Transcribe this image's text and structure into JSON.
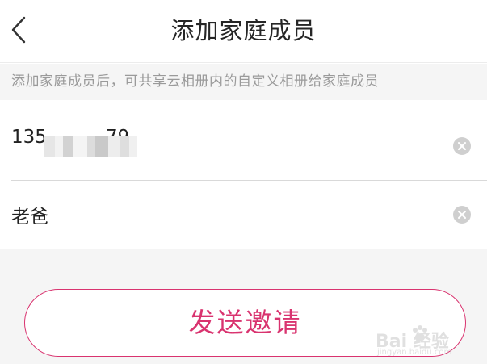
{
  "header": {
    "back_icon": "chevron-left-icon",
    "title": "添加家庭成员"
  },
  "notice": {
    "text": "添加家庭成员后，可共享云相册内的自定义相册给家庭成员"
  },
  "form": {
    "phone": {
      "value": "135          79",
      "clear_icon": "clear-circle-icon"
    },
    "name": {
      "value": "老爸",
      "clear_icon": "clear-circle-icon"
    }
  },
  "actions": {
    "send_invite_label": "发送邀请"
  },
  "colors": {
    "accent": "#d9336f",
    "background_gray": "#f5f5f5",
    "title_text": "#262626",
    "notice_text": "#9a9a9a"
  },
  "watermark": {
    "brand": "Bai 经验",
    "url": "jingyan.baidu.com"
  }
}
